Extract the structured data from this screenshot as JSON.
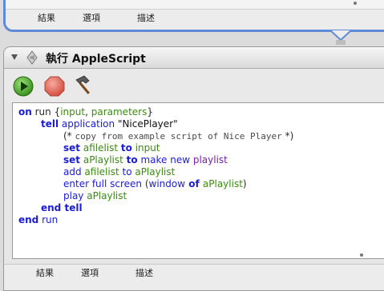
{
  "previous_action": {
    "tabs": [
      "結果",
      "選項",
      "描述"
    ]
  },
  "action": {
    "title": "執行 AppleScript",
    "tabs": [
      "結果",
      "選項",
      "描述"
    ],
    "toolbar": {
      "run": "run-icon",
      "stop": "stop-icon",
      "compile": "hammer-icon"
    }
  },
  "script": {
    "l1": {
      "a": "on",
      "b": " run ",
      "c": "{",
      "d": "input",
      "e": ", ",
      "f": "parameters",
      "g": "}"
    },
    "l2": {
      "a": "tell",
      "b": " application ",
      "c": "\"NicePlayer\""
    },
    "l3": {
      "a": "(* ",
      "b": "copy from example script of Nice Player",
      "c": " *)"
    },
    "l4": {
      "a": "set",
      "b": " afilelist ",
      "c": "to",
      "d": " input"
    },
    "l5": {
      "a": "set",
      "b": " aPlaylist ",
      "c": "to",
      "d": " make new ",
      "e": "playlist"
    },
    "l6": {
      "a": "add",
      "b": " afilelist ",
      "c": "to",
      "d": " aPlaylist"
    },
    "l7": {
      "a": "enter full screen",
      "b": " (",
      "c": "window",
      "d": " of ",
      "e": "aPlaylist",
      "f": ")"
    },
    "l8": {
      "a": "play",
      "b": " aPlaylist"
    },
    "l9": {
      "a": "end",
      "b": " tell"
    },
    "l10": {
      "a": "end",
      "b": " run"
    }
  },
  "colors": {
    "keyword": "#1b1bd6",
    "variable": "#3c8a13",
    "accent": "#5e8ad8"
  }
}
